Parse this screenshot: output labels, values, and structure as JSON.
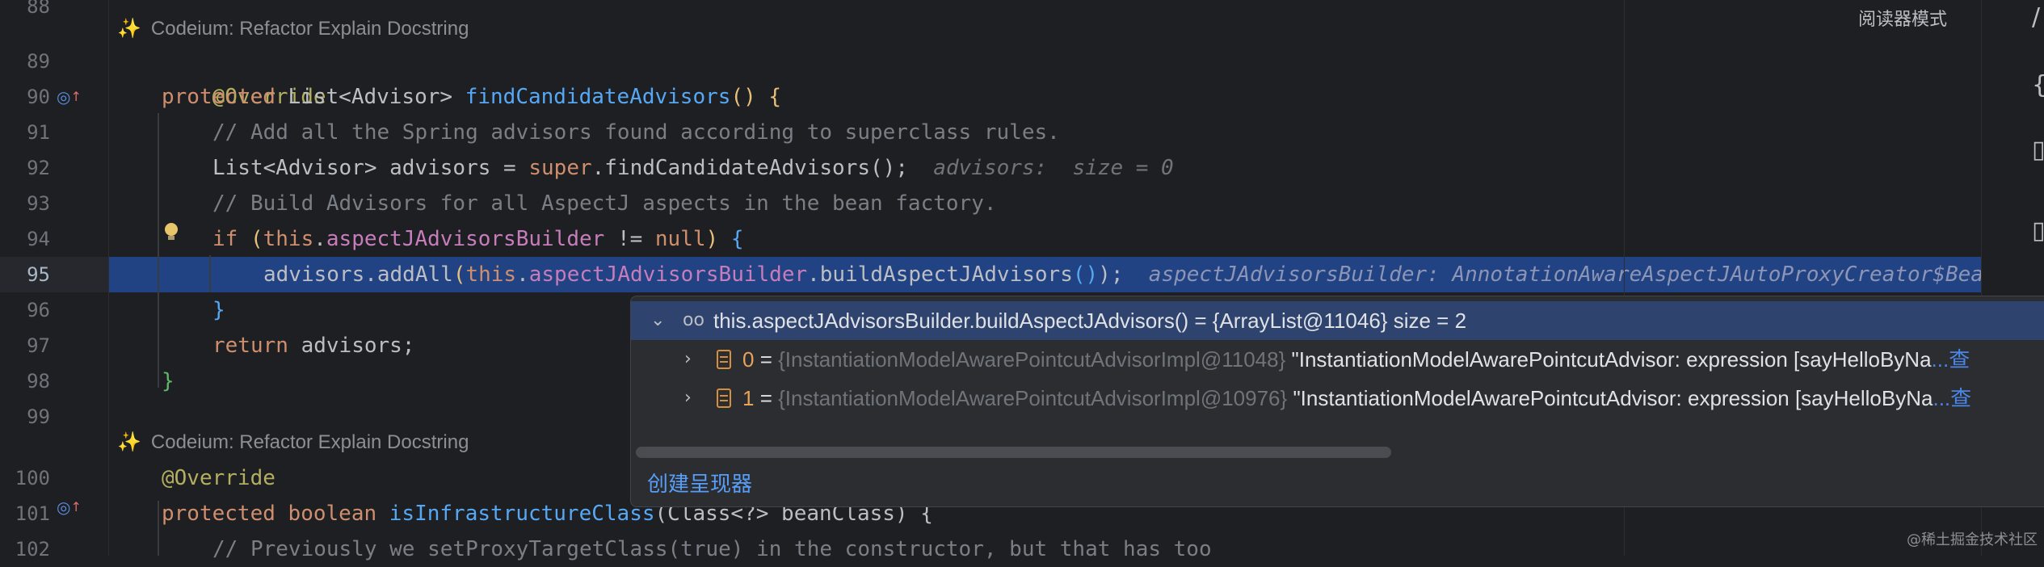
{
  "line_numbers": [
    "88",
    "89",
    "90",
    "91",
    "92",
    "93",
    "94",
    "95",
    "96",
    "97",
    "98",
    "99",
    "100",
    "101",
    "102"
  ],
  "codeium_lens": {
    "prefix": "Codeium:",
    "refactor": "Refactor",
    "explain": "Explain",
    "docstring": "Docstring"
  },
  "code": {
    "l89_override": "@Override",
    "l90_protected": "protected",
    "l90_type": "List<Advisor>",
    "l90_method": "findCandidateAdvisors",
    "l90_paren": "()",
    "l90_brace": "{",
    "l91_comment": "// Add all the Spring advisors found according to superclass rules.",
    "l92_type": "List<Advisor>",
    "l92_var": "advisors",
    "l92_eq": "=",
    "l92_super": "super",
    "l92_call": ".findCandidateAdvisors();",
    "l92_hint": "advisors:  size = 0",
    "l93_comment": "// Build Advisors for all AspectJ aspects in the bean factory.",
    "l94_if": "if",
    "l94_open": "(",
    "l94_this": "this",
    "l94_dot": ".",
    "l94_field": "aspectJAdvisorsBuilder",
    "l94_neq": "!=",
    "l94_null": "null",
    "l94_close": ")",
    "l94_brace": "{",
    "l95_advisors": "advisors.addAll",
    "l95_open": "(",
    "l95_this": "this",
    "l95_dot": ".",
    "l95_field": "aspectJAdvisorsBuilder",
    "l95_call": ".buildAspectJAdvisors",
    "l95_callparens": "()",
    "l95_close": ");",
    "l95_hint": "aspectJAdvisorsBuilder: AnnotationAwareAspectJAutoProxyCreator$BeanFa",
    "l96_brace": "}",
    "l97_return": "return",
    "l97_val": "advisors;",
    "l98_brace": "}",
    "l100_override": "@Override",
    "l101_protected": "protected",
    "l101_boolean": "boolean",
    "l101_method": "isInfrastructureClass",
    "l101_rest": "(Class<?> beanClass) {",
    "l102_comment": "// Previously we setProxyTargetClass(true) in the constructor, but that has too"
  },
  "toolbar": {
    "reader_mode": "阅读器模式"
  },
  "debug_popup": {
    "head_expression": "this.aspectJAdvisorsBuilder.buildAspectJAdvisors() = {ArrayList@11046}  size = 2",
    "items": [
      {
        "index": "0",
        "eq": "=",
        "type": "{InstantiationModelAwarePointcutAdvisorImpl@11048}",
        "value": "\"InstantiationModelAwarePointcutAdvisor: expression [sayHelloByNa",
        "more": "...查"
      },
      {
        "index": "1",
        "eq": "=",
        "type": "{InstantiationModelAwarePointcutAdvisorImpl@10976}",
        "value": "\"InstantiationModelAwarePointcutAdvisor: expression [sayHelloByNa",
        "more": "...查"
      }
    ],
    "create_renderer": "创建呈现器"
  },
  "watermark": "@稀土掘金技术社区"
}
